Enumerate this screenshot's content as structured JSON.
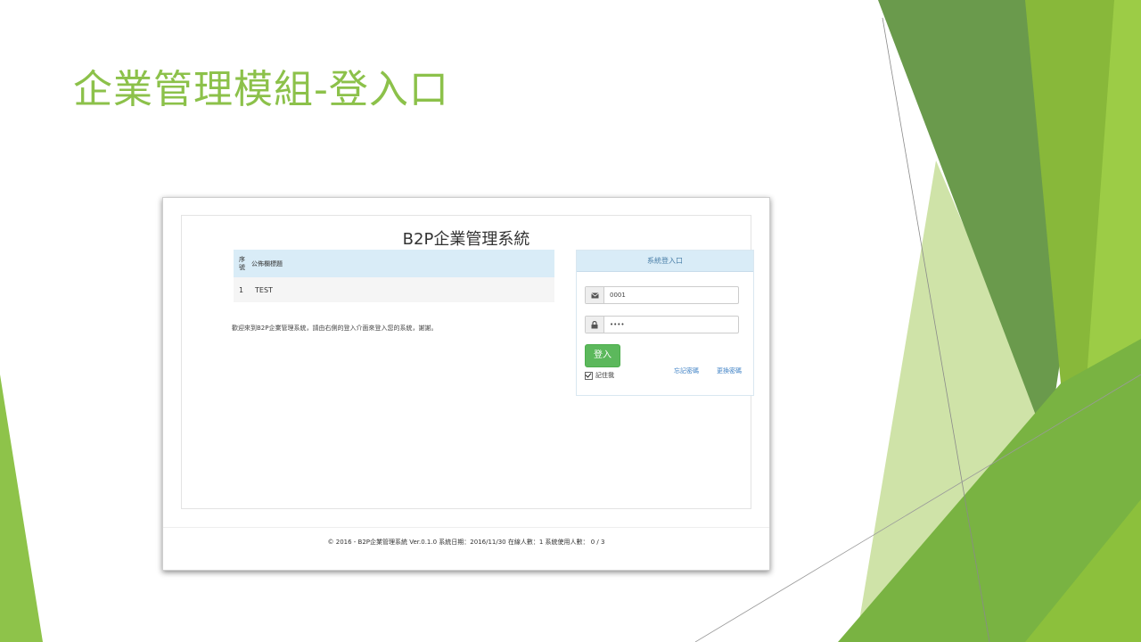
{
  "slide": {
    "title": "企業管理模組-登入口",
    "accent_color": "#8cc14a"
  },
  "app": {
    "system_title": "B2P企業管理系統",
    "notice_table": {
      "headers": {
        "seq": "序號",
        "title": "公佈欄標題"
      },
      "rows": [
        {
          "seq": "1",
          "title": "TEST"
        }
      ]
    },
    "welcome_text": "歡迎來到B2P企業管理系統，請由右側的登入介面來登入您的系統，謝謝。",
    "login": {
      "header": "系統登入口",
      "username_value": "0001",
      "password_value": "••••",
      "submit_label": "登入",
      "remember_label": "記住我",
      "forgot_label": "忘記密碼",
      "change_label": "更換密碼",
      "user_icon": "envelope-icon",
      "pass_icon": "lock-icon",
      "button_color": "#5cb85c"
    },
    "footer": "© 2016 - B2P企業管理系統 Ver.0.1.0 系統日期：2016/11/30 在線人數：1 系統使用人數： 0 / 3"
  }
}
